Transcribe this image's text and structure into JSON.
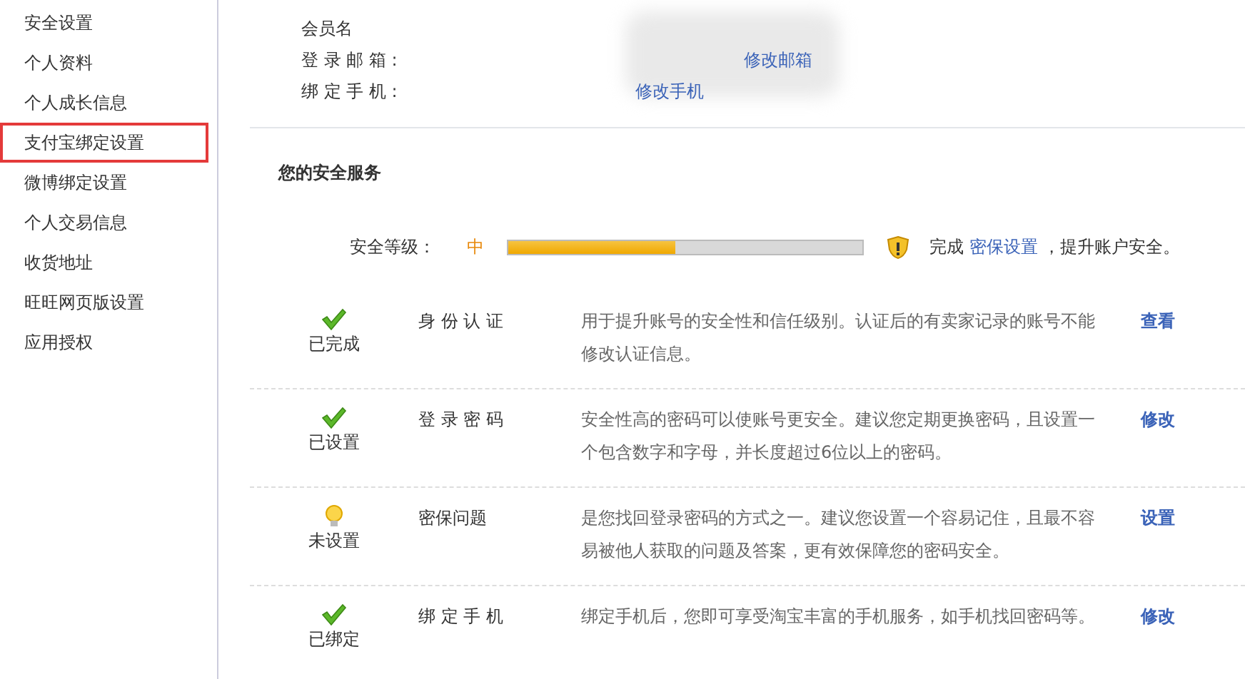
{
  "sidebar": {
    "items": [
      {
        "label": "安全设置",
        "highlighted": false
      },
      {
        "label": "个人资料",
        "highlighted": false
      },
      {
        "label": "个人成长信息",
        "highlighted": false
      },
      {
        "label": "支付宝绑定设置",
        "highlighted": true
      },
      {
        "label": "微博绑定设置",
        "highlighted": false
      },
      {
        "label": "个人交易信息",
        "highlighted": false
      },
      {
        "label": "收货地址",
        "highlighted": false
      },
      {
        "label": "旺旺网页版设置",
        "highlighted": false
      },
      {
        "label": "应用授权",
        "highlighted": false
      }
    ]
  },
  "basic_info": {
    "fields": [
      {
        "label": "会员名"
      },
      {
        "label": "登 录 邮 箱 :",
        "link": "修改邮箱"
      },
      {
        "label": "绑 定 手 机 :",
        "link": "修改手机"
      }
    ]
  },
  "security": {
    "title": "您的安全服务",
    "level_label": "安全等级：",
    "level_text": "中",
    "level": 0.47,
    "tip_prefix": "完成",
    "tip_link": "密保设置",
    "tip_suffix": "，提升账户安全。",
    "items": [
      {
        "kind": "done",
        "status": "已完成",
        "name": "身 份 认 证",
        "description": "用于提升账号的安全性和信任级别。认证后的有卖家记录的账号不能修改认证信息。",
        "action": "查看"
      },
      {
        "kind": "done",
        "status": "已设置",
        "name": "登 录 密 码",
        "description": "安全性高的密码可以使账号更安全。建议您定期更换密码，且设置一个包含数字和字母，并长度超过6位以上的密码。",
        "action": "修改"
      },
      {
        "kind": "todo",
        "status": "未设置",
        "name": "密保问题",
        "description": "是您找回登录密码的方式之一。建议您设置一个容易记住，且最不容易被他人获取的问题及答案，更有效保障您的密码安全。",
        "action": "设置"
      },
      {
        "kind": "done",
        "status": "已绑定",
        "name": "绑 定 手 机",
        "description": "绑定手机后，您即可享受淘宝丰富的手机服务，如手机找回密码等。",
        "action": "修改"
      }
    ]
  }
}
